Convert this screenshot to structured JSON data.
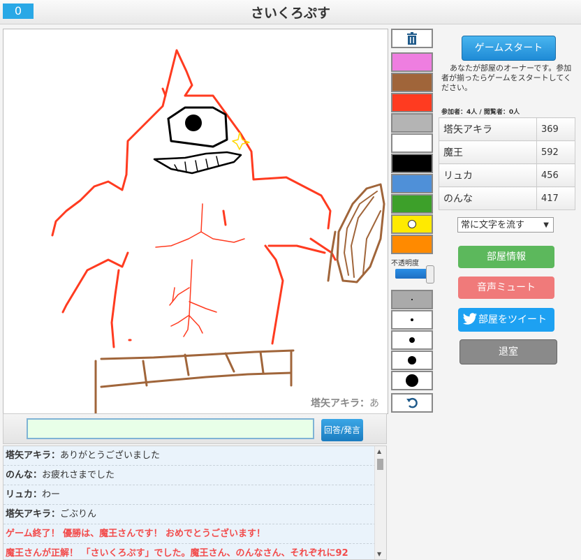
{
  "header": {
    "score": "0",
    "title": "さいくろぷす"
  },
  "canvas": {
    "drawer_name": "塔矢アキラ：",
    "drawer_message": "あ"
  },
  "palette": {
    "colors": [
      "#ee7ee0",
      "#a0653a",
      "#ff3b20",
      "#b4b4b4",
      "#ffffff",
      "#000000",
      "#4f90d8",
      "#3da02a",
      "#ffea00",
      "#ff8a00"
    ],
    "opacity_label": "不透明度"
  },
  "sidebar": {
    "start_button": "ゲームスタート",
    "owner_note": "あなたが部屋のオーナーです。参加者が揃ったらゲームをスタートしてください。",
    "counts": "参加者：4人 / 閲覧者：0人",
    "players": [
      {
        "name": "塔矢アキラ",
        "score": "369"
      },
      {
        "name": "魔王",
        "score": "592"
      },
      {
        "name": "リュカ",
        "score": "456"
      },
      {
        "name": "のんな",
        "score": "417"
      }
    ],
    "scroll_mode": "常に文字を流す",
    "room_info_button": "部屋情報",
    "mute_button": "音声ミュート",
    "tweet_button": "部屋をツイート",
    "leave_button": "退室"
  },
  "chat_input": {
    "value": "",
    "send_button": "回答/発言"
  },
  "chat": [
    {
      "who": "塔矢アキラ：",
      "text": "ありがとうございました",
      "system": false
    },
    {
      "who": "のんな：",
      "text": "お疲れさまでした",
      "system": false
    },
    {
      "who": "リュカ：",
      "text": "わー",
      "system": false
    },
    {
      "who": "塔矢アキラ：",
      "text": "ごぶりん",
      "system": false
    },
    {
      "who": "",
      "text": "ゲーム終了！ 優勝は、魔王さんです！ おめでとうございます！",
      "system": true
    },
    {
      "who": "",
      "text": "魔王さんが正解！ 「さいくろぷす」でした。魔王さん、のんなさん、それぞれに92",
      "system": true
    }
  ]
}
